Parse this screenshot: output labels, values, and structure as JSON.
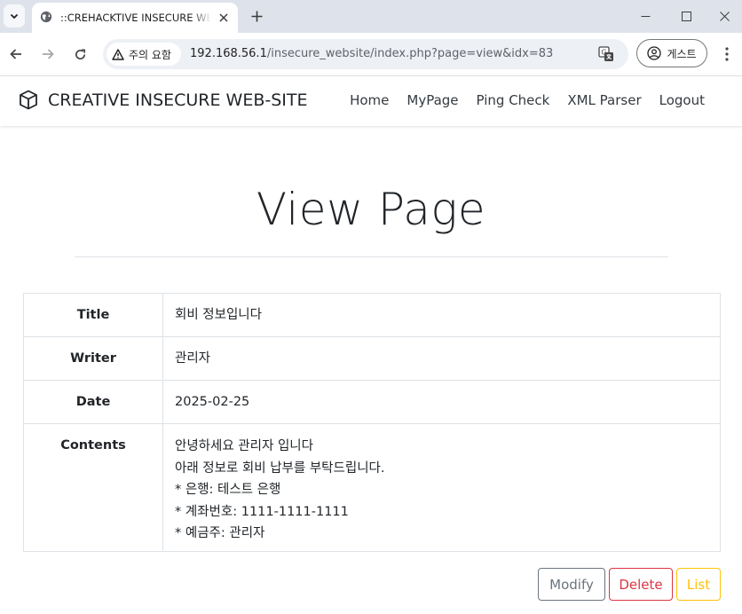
{
  "browser": {
    "tab_title": "::CREHACKTIVE INSECURE WEB",
    "security_label": "주의 요함",
    "url_host": "192.168.56.1",
    "url_path": "/insecure_website/index.php?page=view&idx=83",
    "profile_label": "게스트",
    "icons": {
      "tab_menu": "chevron-down-icon",
      "favicon": "globe-icon",
      "close": "close-icon",
      "new_tab": "plus-icon",
      "back": "arrow-left-icon",
      "forward": "arrow-right-icon",
      "reload": "reload-icon",
      "warning": "warning-icon",
      "translate": "translate-icon",
      "profile": "profile-icon",
      "menu": "kebab-menu-icon"
    }
  },
  "site": {
    "brand": "CREATIVE INSECURE WEB-SITE",
    "nav": [
      "Home",
      "MyPage",
      "Ping Check",
      "XML Parser",
      "Logout"
    ]
  },
  "page": {
    "title": "View Page",
    "labels": {
      "title": "Title",
      "writer": "Writer",
      "date": "Date",
      "contents": "Contents"
    },
    "post": {
      "title": "회비 정보입니다",
      "writer": "관리자",
      "date": "2025-02-25",
      "contents": [
        "안녕하세요 관리자 입니다",
        "아래 정보로 회비 납부를 부탁드립니다.",
        "* 은행: 테스트 은행",
        "* 계좌번호: 1111-1111-1111",
        "* 예금주: 관리자"
      ]
    },
    "buttons": {
      "modify": "Modify",
      "delete": "Delete",
      "list": "List"
    }
  },
  "colors": {
    "modify": "#6c757d",
    "delete": "#dc3545",
    "list": "#ffc107",
    "tabbar": "#dee3eb"
  }
}
